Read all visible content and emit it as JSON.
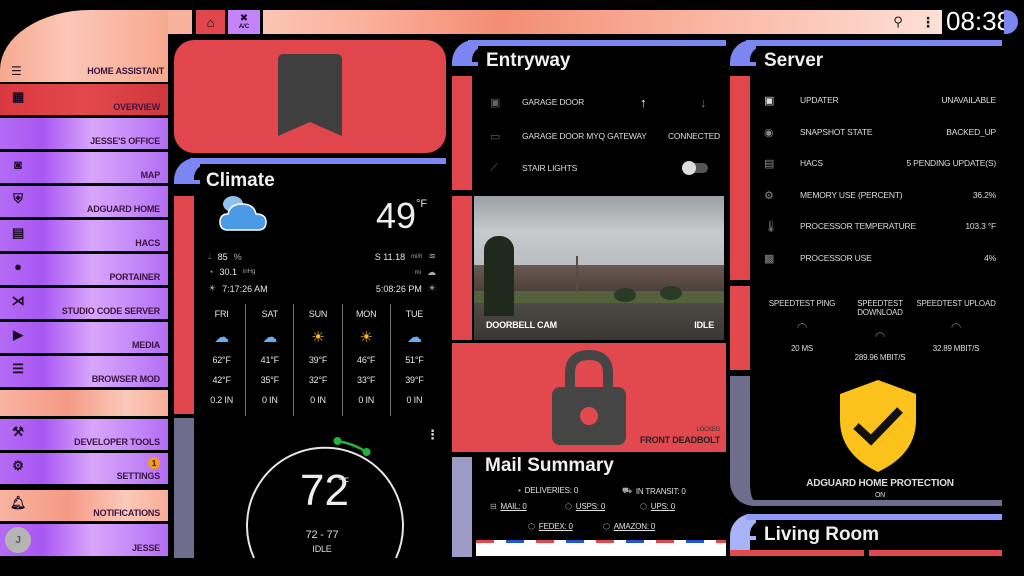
{
  "colors": {
    "accent_blue": "#7b86f2",
    "accent_red": "#e0464b",
    "accent_purple": "#c483f6",
    "accent_peach": "#f8b29b",
    "muted_lavender": "#6f6d8e",
    "adguard_yellow": "#fbc21b",
    "thermostat_green": "#22b33a"
  },
  "sidebar": {
    "title": "Home Assistant",
    "items": [
      {
        "label": "Overview",
        "icon": "dashboard-icon"
      },
      {
        "label": "Jesse's Office",
        "icon": ""
      },
      {
        "label": "Map",
        "icon": "map-person-icon"
      },
      {
        "label": "AdGuard Home",
        "icon": "shield-check-icon"
      },
      {
        "label": "HACS",
        "icon": "hacs-store-icon"
      },
      {
        "label": "Portainer",
        "icon": "docker-whale-icon"
      },
      {
        "label": "Studio Code Server",
        "icon": "vscode-icon"
      },
      {
        "label": "Media",
        "icon": "media-play-icon"
      },
      {
        "label": "Browser Mod",
        "icon": "server-stack-icon"
      },
      {
        "label": "Developer Tools",
        "icon": "hammer-icon"
      },
      {
        "label": "Settings",
        "icon": "gear-icon",
        "badge": "1"
      },
      {
        "label": "Notifications",
        "icon": "bell-icon"
      },
      {
        "label": "Jesse",
        "avatar_initial": "J"
      }
    ]
  },
  "topbar": {
    "home_icon": "home-icon",
    "ac_label": "A/C",
    "clock": "08:38"
  },
  "climate": {
    "title": "Climate",
    "temperature": "49",
    "unit": "°F",
    "humidity": "85",
    "humidity_unit": "%",
    "pressure": "30.1",
    "pressure_unit": "inHg",
    "sunrise": "7:17:26 AM",
    "wind": "S 11.18",
    "wind_unit": "mi/h",
    "visibility_unit": "mi",
    "sunset": "5:08:26 PM",
    "forecast": [
      {
        "day": "Fri",
        "icon": "partly-cloudy",
        "high": "62°F",
        "low": "42°F",
        "precip": "0.2 in"
      },
      {
        "day": "Sat",
        "icon": "partly-cloudy",
        "high": "41°F",
        "low": "35°F",
        "precip": "0 in"
      },
      {
        "day": "Sun",
        "icon": "sunny",
        "high": "39°F",
        "low": "32°F",
        "precip": "0 in"
      },
      {
        "day": "Mon",
        "icon": "sunny",
        "high": "46°F",
        "low": "33°F",
        "precip": "0 in"
      },
      {
        "day": "Tue",
        "icon": "partly-cloudy",
        "high": "51°F",
        "low": "39°F",
        "precip": "0 in"
      }
    ]
  },
  "thermostat": {
    "current": "72",
    "unit": "°F",
    "range": "72 - 77",
    "state": "Idle",
    "setpoint_low": 72,
    "setpoint_high": 77
  },
  "entryway": {
    "title": "Entryway",
    "rows": [
      {
        "label": "Garage Door",
        "icon": "garage-icon"
      },
      {
        "label": "Garage Door MyQ Gateway",
        "icon": "gateway-icon",
        "value": "Connected"
      },
      {
        "label": "Stair Lights",
        "icon": "stairs-icon",
        "toggle": false
      }
    ],
    "camera": {
      "name": "Doorbell Cam",
      "state": "Idle"
    }
  },
  "lock": {
    "state": "Locked",
    "name": "Front Deadbolt"
  },
  "mail": {
    "title": "Mail Summary",
    "deliveries": "Deliveries: 0",
    "in_transit": "In Transit: 0",
    "mail": "Mail: 0",
    "usps": "USPS: 0",
    "ups": "UPS: 0",
    "fedex": "FedEx: 0",
    "amazon": "Amazon: 0"
  },
  "server": {
    "title": "Server",
    "rows": [
      {
        "label": "Updater",
        "value": "unavailable",
        "icon": "package-icon"
      },
      {
        "label": "Snapshot State",
        "value": "backed_up",
        "icon": "eye-icon"
      },
      {
        "label": "HACS",
        "value": "5 pending update(s)",
        "icon": "hacs-store-icon"
      },
      {
        "label": "Memory Use (Percent)",
        "value": "36.2%",
        "icon": "memory-icon"
      },
      {
        "label": "Processor Temperature",
        "value": "103.3 °F",
        "icon": "thermometer-icon"
      },
      {
        "label": "Processor Use",
        "value": "4%",
        "icon": "cpu-icon"
      }
    ],
    "speedtest": [
      {
        "label": "Speedtest Ping",
        "value": "20 ms"
      },
      {
        "label": "Speedtest Download",
        "value": "289.96 Mbit/s"
      },
      {
        "label": "Speedtest Upload",
        "value": "32.89 Mbit/s"
      }
    ],
    "adguard": {
      "label": "AdGuard Home Protection",
      "state": "on"
    }
  },
  "living_room": {
    "title": "Living Room"
  }
}
